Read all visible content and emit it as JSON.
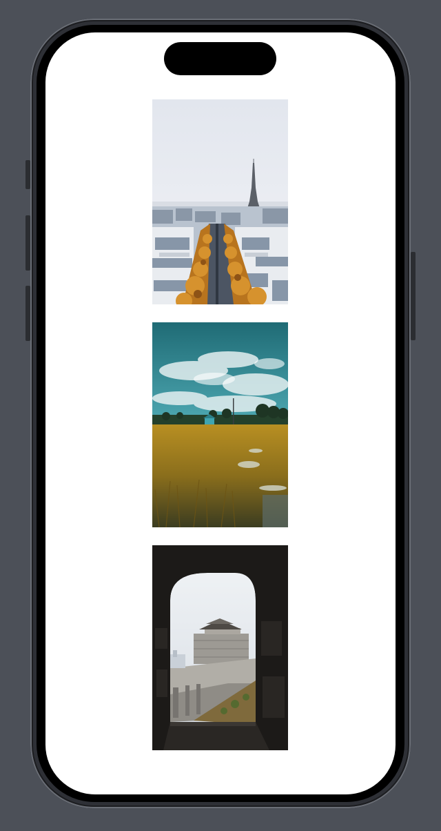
{
  "device": {
    "frame_color": "#2e3036",
    "bezel_color": "#000000",
    "screen_color": "#ffffff",
    "background_color": "#4c5058"
  },
  "gallery": {
    "photos": [
      {
        "subject": "paris-eiffel-tower-avenue"
      },
      {
        "subject": "field-with-small-house-under-teal-sky"
      },
      {
        "subject": "stone-archway-view-of-fortress-tower"
      }
    ]
  }
}
